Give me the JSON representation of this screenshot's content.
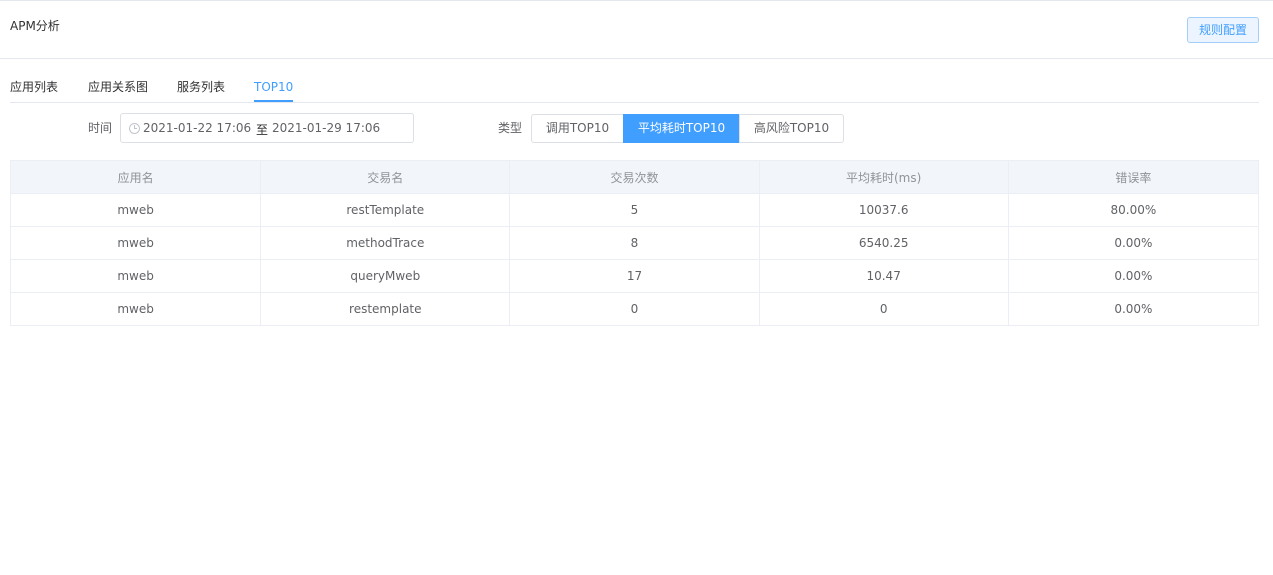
{
  "header": {
    "title": "APM分析",
    "rule_button": "规则配置"
  },
  "tabs": [
    {
      "label": "应用列表",
      "active": false
    },
    {
      "label": "应用关系图",
      "active": false
    },
    {
      "label": "服务列表",
      "active": false
    },
    {
      "label": "TOP10",
      "active": true
    }
  ],
  "filters": {
    "time_label": "时间",
    "start_date": "2021-01-22 17:06:49",
    "range_separator": "至",
    "end_date": "2021-01-29 17:06:49",
    "type_label": "类型",
    "type_options": [
      "调用TOP10",
      "平均耗时TOP10",
      "高风险TOP10"
    ],
    "type_selected": "平均耗时TOP10"
  },
  "table": {
    "columns": [
      "应用名",
      "交易名",
      "交易次数",
      "平均耗时(ms)",
      "错误率"
    ],
    "rows": [
      [
        "mweb",
        "restTemplate",
        "5",
        "10037.6",
        "80.00%"
      ],
      [
        "mweb",
        "methodTrace",
        "8",
        "6540.25",
        "0.00%"
      ],
      [
        "mweb",
        "queryMweb",
        "17",
        "10.47",
        "0.00%"
      ],
      [
        "mweb",
        "restemplate",
        "0",
        "0",
        "0.00%"
      ]
    ]
  },
  "colors": {
    "accent": "#409eff",
    "header_bg": "#f2f5f9",
    "border": "#ebeef5"
  }
}
